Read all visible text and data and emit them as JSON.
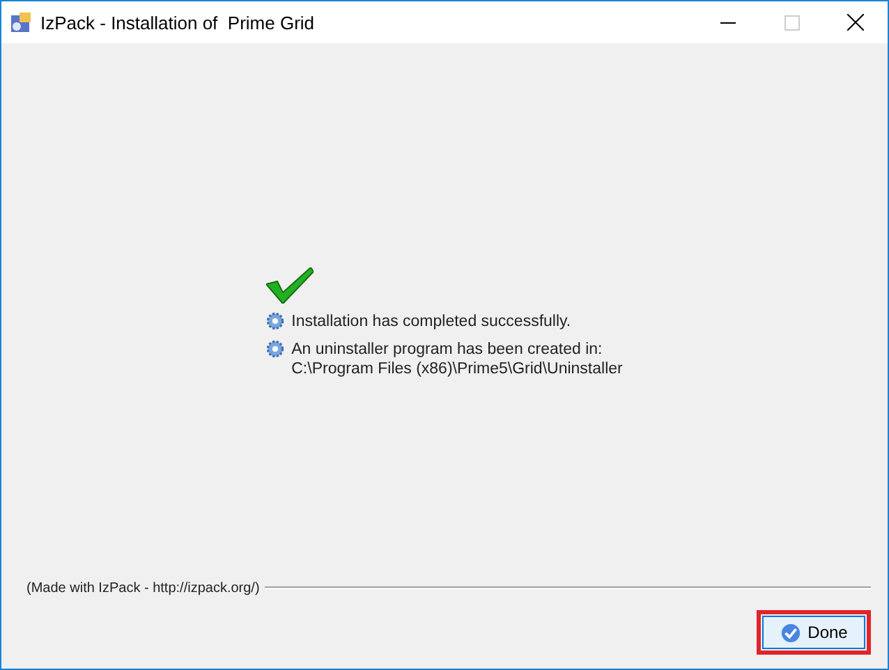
{
  "window": {
    "title": "IzPack - Installation of  Prime Grid"
  },
  "messages": [
    {
      "text": "Installation has completed successfully."
    },
    {
      "text": "An uninstaller program has been created in:",
      "detail": "C:\\Program Files (x86)\\Prime5\\Grid\\Uninstaller"
    }
  ],
  "footer": {
    "credit": "(Made with IzPack - http://izpack.org/)"
  },
  "buttons": [
    {
      "label": "Done",
      "highlighted": true
    }
  ]
}
